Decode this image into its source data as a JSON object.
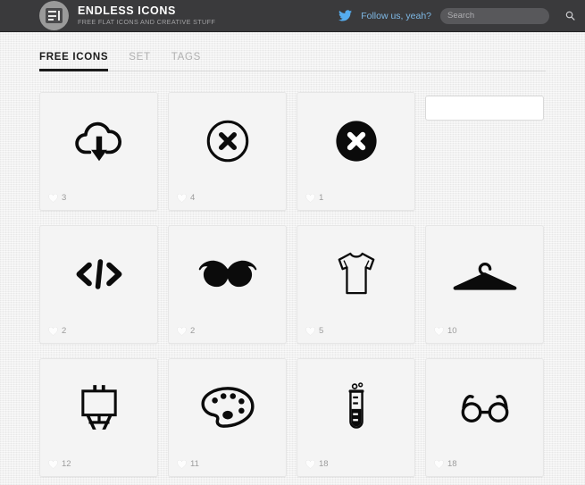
{
  "header": {
    "logo_icon": "endless-icons-logo",
    "brand_title": "ENDLESS ICONS",
    "brand_subtitle": "FREE FLAT ICONS AND CREATIVE STUFF",
    "twitter_icon": "twitter-bird-icon",
    "follow_text": "Follow us, yeah?",
    "search": {
      "placeholder": "Search",
      "value": "",
      "icon": "search-icon"
    },
    "bar_color": "#3a3a3c",
    "accent_color": "#7fb9e6"
  },
  "nav": {
    "tabs": [
      {
        "label": "FREE ICONS",
        "active": true
      },
      {
        "label": "SET",
        "active": false
      },
      {
        "label": "TAGS",
        "active": false
      }
    ]
  },
  "grid": {
    "like_icon": "heart-icon",
    "empty_field": {
      "value": "",
      "placeholder": ""
    },
    "items": [
      {
        "icon": "cloud-download-icon",
        "likes": "3"
      },
      {
        "icon": "close-circle-outline-icon",
        "likes": "4"
      },
      {
        "icon": "close-circle-filled-icon",
        "likes": "1"
      },
      {
        "icon": "code-brackets-icon",
        "likes": "2"
      },
      {
        "icon": "mustache-icon",
        "likes": "2"
      },
      {
        "icon": "tshirt-icon",
        "likes": "5"
      },
      {
        "icon": "clothes-hanger-icon",
        "likes": "10"
      },
      {
        "icon": "easel-icon",
        "likes": "12"
      },
      {
        "icon": "paint-palette-icon",
        "likes": "11"
      },
      {
        "icon": "test-tube-icon",
        "likes": "18"
      },
      {
        "icon": "eyeglasses-icon",
        "likes": "18"
      }
    ]
  }
}
